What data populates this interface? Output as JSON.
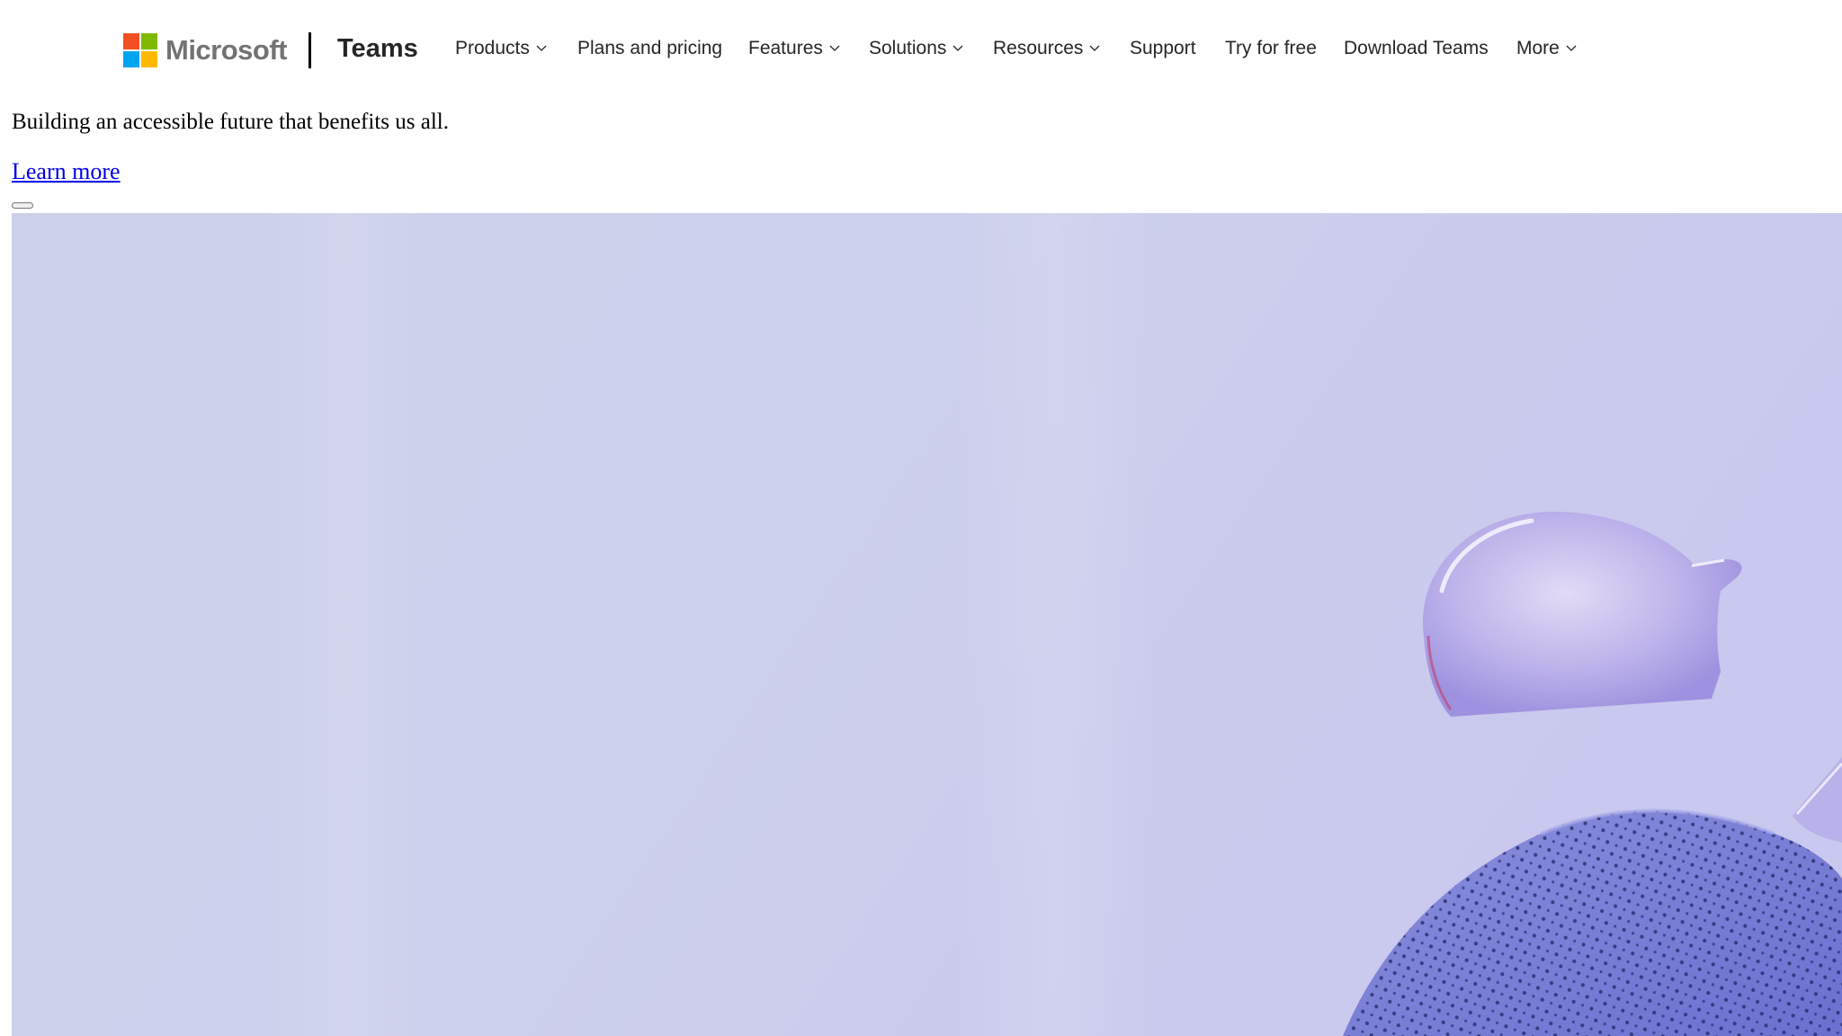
{
  "header": {
    "logo_text": "Microsoft",
    "logo_colors": [
      "#f25022",
      "#7fba00",
      "#00a4ef",
      "#ffb900"
    ],
    "product_name": "Teams",
    "nav": [
      {
        "label": "Products",
        "has_dropdown": true,
        "icon": "chevron-down-icon"
      },
      {
        "label": "Plans and pricing",
        "has_dropdown": false
      },
      {
        "label": "Features",
        "has_dropdown": true,
        "icon": "chevron-down-icon"
      },
      {
        "label": "Solutions",
        "has_dropdown": true,
        "icon": "chevron-down-icon"
      },
      {
        "label": "Resources",
        "has_dropdown": true,
        "icon": "chevron-down-icon"
      },
      {
        "label": "Support",
        "has_dropdown": false
      },
      {
        "label": "Try for free",
        "has_dropdown": false
      },
      {
        "label": "Download Teams",
        "has_dropdown": false
      },
      {
        "label": "More",
        "has_dropdown": true,
        "icon": "chevron-down-icon"
      }
    ]
  },
  "main": {
    "tagline": "Building an accessible future that benefits us all.",
    "link_text": "Learn more",
    "link_color": "#0000ee"
  },
  "hero": {
    "background_color": "#cdd0ec",
    "accent_color": "#7b7fd6"
  }
}
